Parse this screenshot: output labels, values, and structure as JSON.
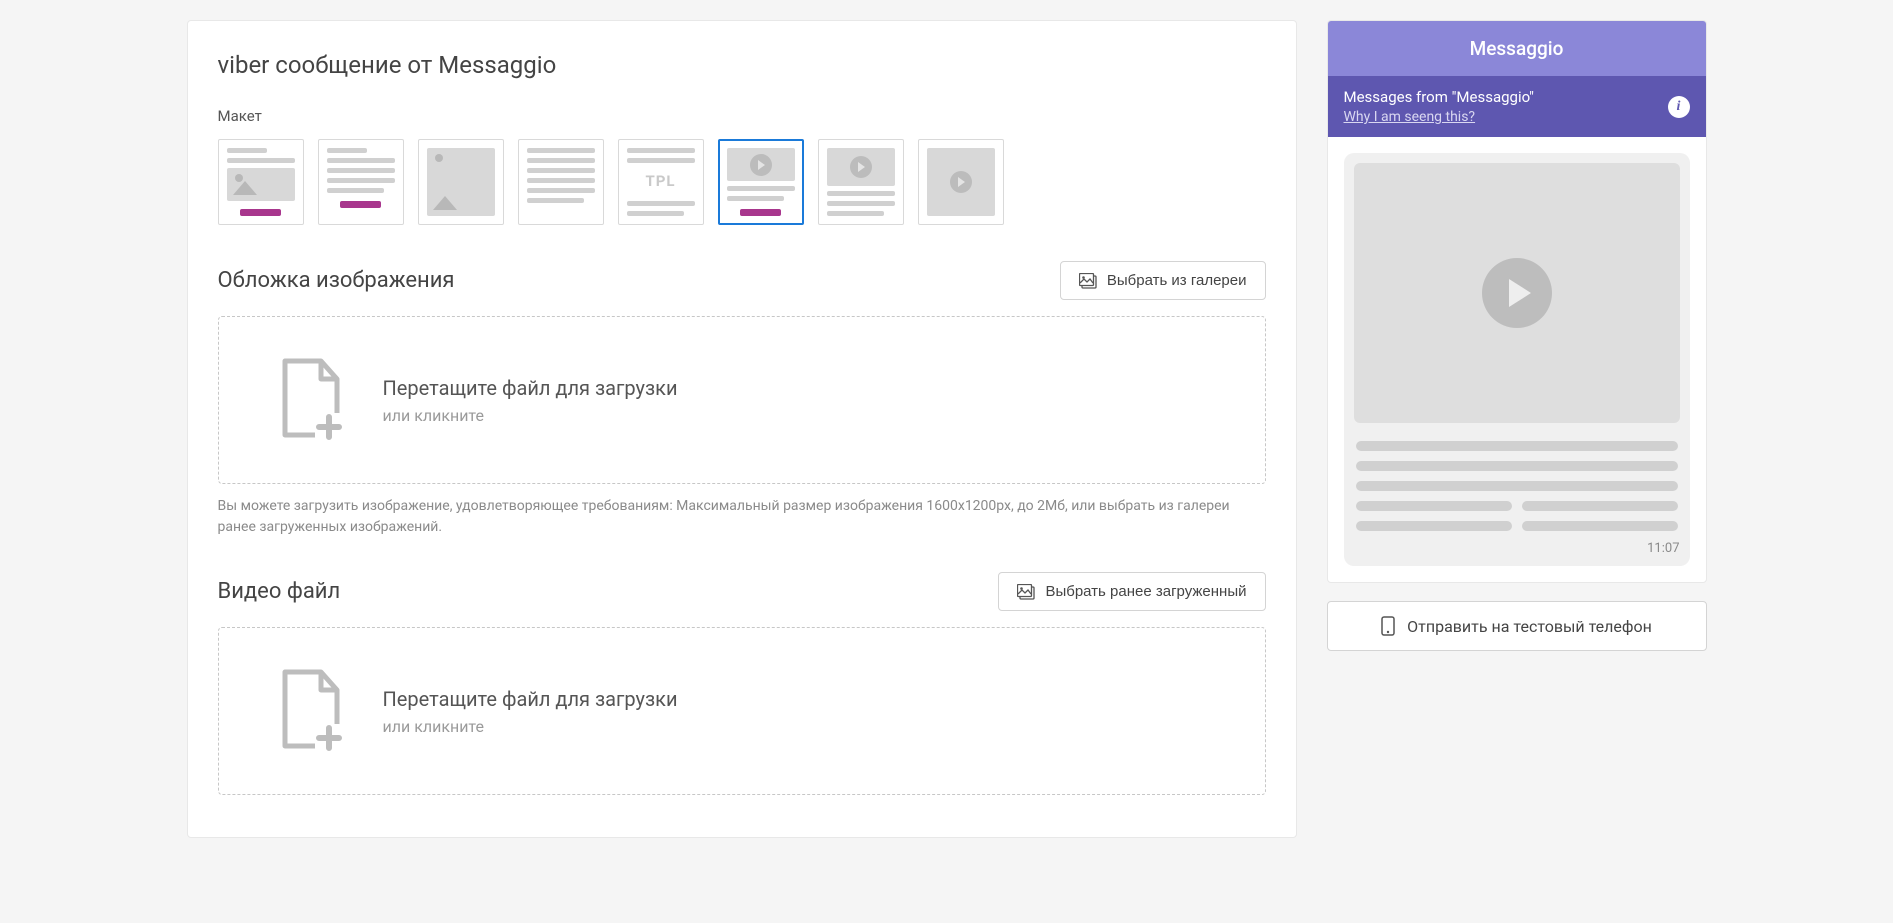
{
  "header": {
    "title": "viber сообщение от Messaggio"
  },
  "layout": {
    "label": "Макет",
    "selected_index": 5
  },
  "cover": {
    "title": "Обложка изображения",
    "gallery_button": "Выбрать из галереи",
    "dropzone_main": "Перетащите файл для загрузки",
    "dropzone_sub": "или кликните",
    "hint": "Вы можете загрузить изображение, удовлетворяющее требованиям: Максимальный размер изображения 1600х1200px, до 2Мб, или выбрать из галереи ранее загруженных изображений."
  },
  "video": {
    "title": "Видео файл",
    "gallery_button": "Выбрать ранее загруженный",
    "dropzone_main": "Перетащите файл для загрузки",
    "dropzone_sub": "или кликните"
  },
  "preview": {
    "brand": "Messaggio",
    "messages_from": "Messages from \"Messaggio\"",
    "why_link": "Why I am seeng this?",
    "time": "11:07",
    "send_test": "Отправить на тестовый телефон"
  }
}
